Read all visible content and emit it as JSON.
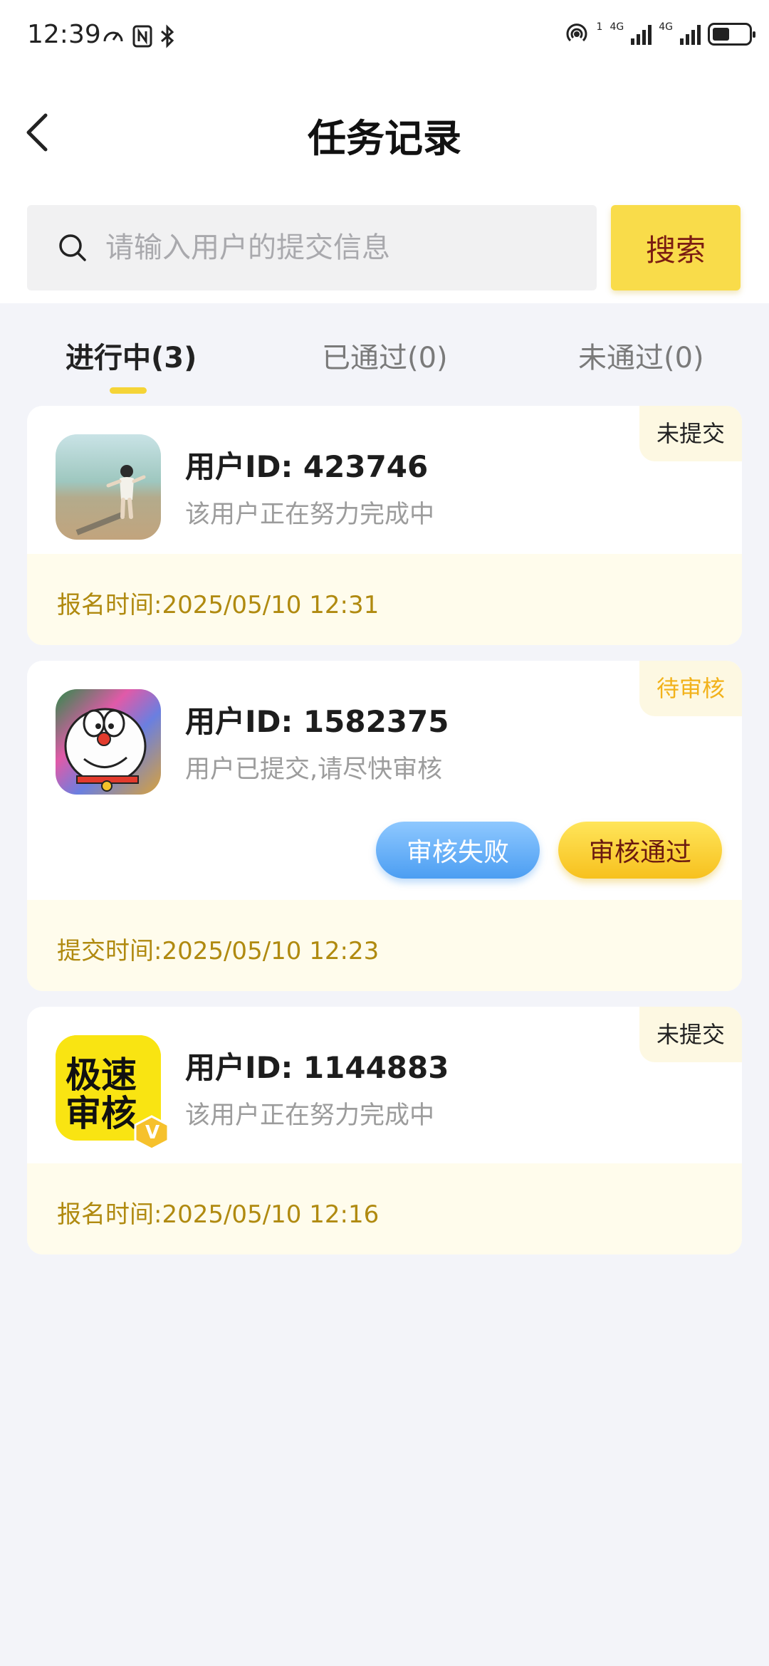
{
  "status_bar": {
    "time": "12:39",
    "net1": "4G",
    "net2": "4G",
    "sim_index": "1",
    "battery_percent": 45
  },
  "header": {
    "back_icon": "chevron-left-icon",
    "title": "任务记录"
  },
  "search": {
    "placeholder": "请输入用户的提交信息",
    "value": "",
    "button_label": "搜索",
    "icon": "search-icon"
  },
  "tabs": [
    {
      "label": "进行中(3)",
      "active": true
    },
    {
      "label": "已通过(0)",
      "active": false
    },
    {
      "label": "未通过(0)",
      "active": false
    }
  ],
  "records": [
    {
      "status": "未提交",
      "user_id_label": "用户ID:  423746",
      "description": "该用户正在努力完成中",
      "time_label": "报名时间:2025/05/10 12:31",
      "avatar": "beach-child-photo"
    },
    {
      "status": "待审核",
      "user_id_label": "用户ID:  1582375",
      "description": "用户已提交,请尽快审核",
      "time_label": "提交时间:2025/05/10 12:23",
      "avatar": "doraemon-avatar",
      "actions": {
        "reject": "审核失败",
        "approve": "审核通过"
      }
    },
    {
      "status": "未提交",
      "user_id_label": "用户ID:  1144883",
      "description": "该用户正在努力完成中",
      "time_label": "报名时间:2025/05/10 12:16",
      "avatar": "express-review-logo",
      "avatar_text": [
        "极速",
        "审核"
      ],
      "avatar_badge": "V"
    }
  ],
  "colors": {
    "accent_yellow": "#f9dc4a",
    "foot_text": "#b08a10",
    "pending_badge_text": "#f2b21a",
    "reject_blue": "#4c9ef2"
  }
}
